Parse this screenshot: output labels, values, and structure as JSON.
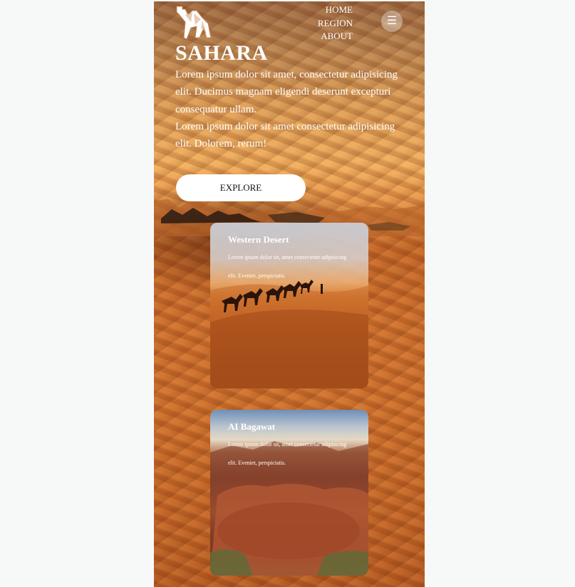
{
  "nav": {
    "links": [
      "HOME",
      "REGION",
      "ABOUT"
    ],
    "menu_icon": "hamburger-icon",
    "menu_glyph": "☰"
  },
  "hero": {
    "title": "SAHARA",
    "paragraph_1": "Lorem ipsum dolor sit amet, consectetur adipisicing elit. Ducimus magnam eligendi deserunt excepturi consequatur ullam.",
    "paragraph_2": "Lorem ipsum dolor sit amet consectetur adipisicing elit. Dolorem, rerum!",
    "button_label": "EXPLORE"
  },
  "cards": [
    {
      "title": "Western Desert",
      "text": "Lorem ipsum dolor sit, amet consectetur adipisicing elit. Eveniet, perspiciatis."
    },
    {
      "title": "AI Bagawat",
      "text": "Lorem ipsum dolor sit, amet consectetur adipisicing elit. Eveniet, perspiciatis."
    }
  ],
  "colors": {
    "page_background": "#f7f8f8",
    "sand": "#d0742f",
    "button_background": "#ffffff",
    "text_light": "#ffffff"
  }
}
